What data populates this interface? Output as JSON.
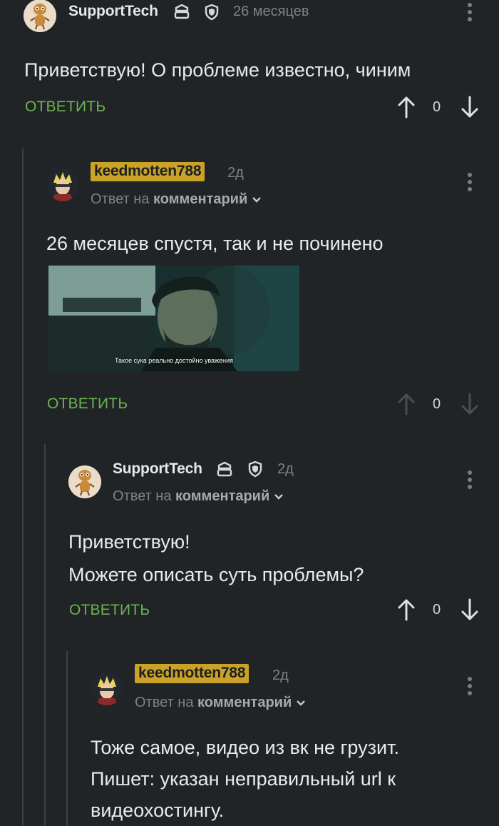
{
  "comments": [
    {
      "username": "SupportTech",
      "time": "26 месяцев",
      "text": [
        "Приветствую! О проблеме известно, чиним"
      ],
      "reply_label": "ОТВЕТИТЬ",
      "votes": "0"
    },
    {
      "username": "keedmotten788",
      "time": "2д",
      "reply_prefix": "Ответ на",
      "reply_target": "комментарий",
      "text": [
        "26 месяцев спустя, так и не починено"
      ],
      "image_caption": "Такое сука реально достойно уважения",
      "reply_label": "ОТВЕТИТЬ",
      "votes": "0"
    },
    {
      "username": "SupportTech",
      "time": "2д",
      "reply_prefix": "Ответ на",
      "reply_target": "комментарий",
      "text": [
        "Приветствую!",
        "Можете описать суть проблемы?"
      ],
      "reply_label": "ОТВЕТИТЬ",
      "votes": "0"
    },
    {
      "username": "keedmotten788",
      "time": "2д",
      "reply_prefix": "Ответ на",
      "reply_target": "комментарий",
      "text": [
        "Тоже самое, видео из вк не грузит.",
        "Пишет: указан неправильный url к",
        "видеохостингу."
      ]
    }
  ],
  "colors": {
    "background": "#212426",
    "reply_green": "#6bb34f",
    "username_highlight": "#c9a227",
    "muted": "#7d8286"
  },
  "icons": [
    "moderator-badge-icon",
    "shield-icon",
    "arrow-up-icon",
    "arrow-down-icon",
    "more-options-icon",
    "chevron-down-icon"
  ]
}
